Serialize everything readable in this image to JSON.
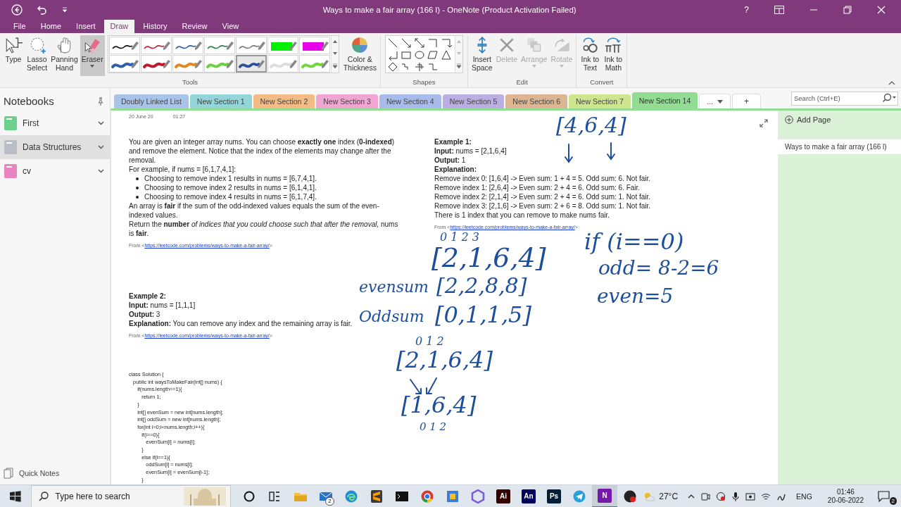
{
  "window": {
    "title": "Ways to make a fair array (166 l) - OneNote (Product Activation Failed)",
    "help": "?"
  },
  "menu_tabs": [
    {
      "label": "File",
      "selected": false
    },
    {
      "label": "Home",
      "selected": false
    },
    {
      "label": "Insert",
      "selected": false
    },
    {
      "label": "Draw",
      "selected": true
    },
    {
      "label": "History",
      "selected": false
    },
    {
      "label": "Review",
      "selected": false
    },
    {
      "label": "View",
      "selected": false
    }
  ],
  "ribbon": {
    "groups": [
      {
        "label": "Tools",
        "items": [
          {
            "kind": "type",
            "label": "Type",
            "selected": false,
            "dropdown": false
          },
          {
            "kind": "lasso",
            "label": "Lasso\nSelect",
            "selected": false,
            "dropdown": false
          },
          {
            "kind": "hand",
            "label": "Panning\nHand",
            "selected": false,
            "dropdown": false
          },
          {
            "kind": "eraser",
            "label": "Eraser",
            "selected": true,
            "dropdown": true
          },
          {
            "kind": "pens",
            "pens": [
              {
                "kind": "pen",
                "color": "#111111",
                "selected": false
              },
              {
                "kind": "pen",
                "color": "#c0243c",
                "selected": false
              },
              {
                "kind": "pen",
                "color": "#2f5f9e",
                "selected": false
              },
              {
                "kind": "pen",
                "color": "#2e7d4f",
                "selected": false
              },
              {
                "kind": "pen",
                "color": "#7a7a7a",
                "selected": false
              },
              {
                "kind": "highlighter",
                "color": "#00f000",
                "selected": false
              },
              {
                "kind": "highlighter",
                "color": "#e800e8",
                "selected": false
              },
              {
                "kind": "marker",
                "color": "#2b5fa8",
                "selected": false
              },
              {
                "kind": "marker",
                "color": "#c0182c",
                "selected": false
              },
              {
                "kind": "marker",
                "color": "#e08a1e",
                "selected": false
              },
              {
                "kind": "marker",
                "color": "#6ad23a",
                "selected": false
              },
              {
                "kind": "marker",
                "color": "#2b4f9e",
                "selected": true
              },
              {
                "kind": "marker",
                "color": "#dddddd",
                "selected": false
              },
              {
                "kind": "marker",
                "color": "#6fd838",
                "selected": false
              }
            ]
          },
          {
            "kind": "color",
            "label": "Color &\nThickness",
            "selected": false,
            "dropdown": false
          }
        ]
      },
      {
        "label": "Shapes",
        "items": [
          {
            "kind": "shapes"
          }
        ]
      },
      {
        "label": "Edit",
        "items": [
          {
            "kind": "insert-space",
            "label": "Insert\nSpace",
            "disabled": false,
            "dropdown": false
          },
          {
            "kind": "delete",
            "label": "Delete",
            "disabled": true,
            "dropdown": false
          },
          {
            "kind": "arrange",
            "label": "Arrange",
            "disabled": true,
            "dropdown": true
          },
          {
            "kind": "rotate",
            "label": "Rotate",
            "disabled": true,
            "dropdown": true
          }
        ]
      },
      {
        "label": "Convert",
        "items": [
          {
            "kind": "ink-text",
            "label": "Ink to\nText",
            "disabled": false,
            "dropdown": false
          },
          {
            "kind": "ink-math",
            "label": "Ink to\nMath",
            "disabled": false,
            "dropdown": false
          }
        ]
      }
    ]
  },
  "notebooks": {
    "title": "Notebooks",
    "items": [
      {
        "name": "First",
        "color": "#6dd08c",
        "selected": false
      },
      {
        "name": "Data Structures",
        "color": "#b9bec6",
        "selected": true
      },
      {
        "name": "cv",
        "color": "#e884c0",
        "selected": false
      }
    ],
    "quick_notes": "Quick Notes"
  },
  "sections": [
    {
      "label": "Doubly Linked List",
      "color": "#a9c4e8",
      "selected": false
    },
    {
      "label": "New Section 1",
      "color": "#93d5d9",
      "selected": false
    },
    {
      "label": "New Section 2",
      "color": "#f3bb85",
      "selected": false
    },
    {
      "label": "New Section 3",
      "color": "#f0a5d2",
      "selected": false
    },
    {
      "label": "New Section 4",
      "color": "#a9bbea",
      "selected": false
    },
    {
      "label": "New Section 5",
      "color": "#bbaee3",
      "selected": false
    },
    {
      "label": "New Section 6",
      "color": "#dcb592",
      "selected": false
    },
    {
      "label": "New Section 7",
      "color": "#cfe690",
      "selected": false
    },
    {
      "label": "New Section 14",
      "color": "#93dc93",
      "selected": true
    }
  ],
  "more_sections": "...",
  "add_section": "+",
  "search": {
    "placeholder": "Search (Ctrl+E)"
  },
  "pages_panel": {
    "add_page": "Add Page",
    "pages": [
      {
        "title": "Ways to make a fair array (166 l)",
        "selected": true
      }
    ]
  },
  "page": {
    "date": "20 June 20",
    "time": "01:27",
    "notes": [
      {
        "blocks": [
          {
            "kind": "p",
            "text": "You are given an integer array nums. You can choose **exactly one** index (**0-indexed**) and remove the element. Notice that the index of the elements may change after the removal."
          },
          {
            "kind": "p",
            "text": "For example, if nums = [6,1,7,4,1]:"
          },
          {
            "kind": "bullet",
            "text": "Choosing to remove index 1 results in nums = [6,7,4,1]."
          },
          {
            "kind": "bullet",
            "text": "Choosing to remove index 2 results in nums = [6,1,4,1]."
          },
          {
            "kind": "bullet",
            "text": "Choosing to remove index 4 results in nums = [6,1,7,4]."
          },
          {
            "kind": "p",
            "text": "An array is **fair** if the sum of the odd-indexed values equals the sum of the even-indexed values."
          },
          {
            "kind": "p",
            "text": "Return the **number** *of indices that you could choose such that after the removal,* nums is **fair**."
          },
          {
            "kind": "source",
            "prefix": "From <",
            "link": "https://leetcode.com/problems/ways-to-make-a-fair-array/",
            "suffix": ">"
          }
        ]
      },
      {
        "blocks": [
          {
            "kind": "p",
            "text": "**Example 1:**"
          },
          {
            "kind": "p",
            "text": "**Input:** nums = [2,1,6,4]"
          },
          {
            "kind": "p",
            "text": "**Output:** 1"
          },
          {
            "kind": "p",
            "text": "**Explanation:**"
          },
          {
            "kind": "p",
            "text": "Remove index 0: [1,6,4] -> Even sum: 1 + 4 = 5. Odd sum: 6. Not fair."
          },
          {
            "kind": "p",
            "text": "Remove index 1: [2,6,4] -> Even sum: 2 + 4 = 6. Odd sum: 6. Fair."
          },
          {
            "kind": "p",
            "text": "Remove index 2: [2,1,4] -> Even sum: 2 + 4 = 6. Odd sum: 1. Not fair."
          },
          {
            "kind": "p",
            "text": "Remove index 3: [2,1,6] -> Even sum: 2 + 6 = 8. Odd sum: 1. Not fair."
          },
          {
            "kind": "p",
            "text": "There is 1 index that you can remove to make nums fair."
          },
          {
            "kind": "source",
            "prefix": "From <",
            "link": "https://leetcode.com/problems/ways-to-make-a-fair-array/",
            "suffix": ">"
          }
        ]
      },
      {
        "blocks": [
          {
            "kind": "p",
            "text": "**Example 2:**"
          },
          {
            "kind": "p",
            "text": "**Input:** nums = [1,1,1]"
          },
          {
            "kind": "p",
            "text": "**Output:** 3"
          },
          {
            "kind": "p",
            "text": "**Explanation:** You can remove any index and the remaining array is fair."
          },
          {
            "kind": "source",
            "prefix": "From <",
            "link": "https://leetcode.com/problems/ways-to-make-a-fair-array/",
            "suffix": ">"
          }
        ]
      },
      {
        "blocks": [
          {
            "kind": "code",
            "lines": [
              "class Solution {",
              "   public int waysToMakeFair(int[] nums) {",
              "      if(nums.length==1){",
              "         return 1;",
              "      }",
              "      int[] evenSum = new int[nums.length];",
              "      int[] oddSum = new int[nums.length];",
              "      for(int i=0;i<nums.length;i++){",
              "         if(i==0){",
              "            evenSum[i] = nums[i];",
              "         }",
              "         else if(i==1){",
              "            oddSum[i] = nums[i];",
              "            evenSum[i] = evenSum[i-1];",
              "         }"
            ]
          }
        ]
      }
    ],
    "ink": [
      {
        "text": "[4,6,4]"
      },
      {
        "text": "0 1 2 3"
      },
      {
        "text": "[2,1,6,4]"
      },
      {
        "text": "evensum"
      },
      {
        "text": "[2,2,8,8]"
      },
      {
        "text": "Oddsum"
      },
      {
        "text": "[0,1,1,5]"
      },
      {
        "text": "if (i==0)"
      },
      {
        "text": "odd= 8-2=6"
      },
      {
        "text": "even=5"
      },
      {
        "text": "0 1 2"
      },
      {
        "text": "[2,1,6,4]"
      },
      {
        "text": "[1,6,4]"
      },
      {
        "text": "0 1 2"
      }
    ]
  },
  "taskbar": {
    "search_placeholder": "Type here to search",
    "apps": [
      {
        "kind": "cortana",
        "active": false
      },
      {
        "kind": "task-view",
        "active": false
      },
      {
        "kind": "folder",
        "active": false
      },
      {
        "kind": "mail",
        "badge": "2",
        "active": false
      },
      {
        "kind": "edge",
        "active": false
      },
      {
        "kind": "sublime",
        "active": false
      },
      {
        "kind": "terminal",
        "active": false
      },
      {
        "kind": "chrome",
        "active": false
      },
      {
        "kind": "box",
        "active": false
      },
      {
        "kind": "hexagon",
        "active": false
      },
      {
        "kind": "letter",
        "label": "Ai",
        "color": "#330000",
        "active": false
      },
      {
        "kind": "letter",
        "label": "An",
        "color": "#00005b",
        "active": false
      },
      {
        "kind": "letter",
        "label": "Ps",
        "color": "#001e36",
        "active": false
      },
      {
        "kind": "telegram",
        "active": false
      },
      {
        "kind": "letter",
        "label": "N",
        "color": "#7719aa",
        "active": true
      },
      {
        "kind": "record",
        "active": false
      }
    ],
    "weather": "27°C",
    "language": "ENG",
    "time": "01:46",
    "date": "20-06-2022",
    "notifications": "2"
  }
}
